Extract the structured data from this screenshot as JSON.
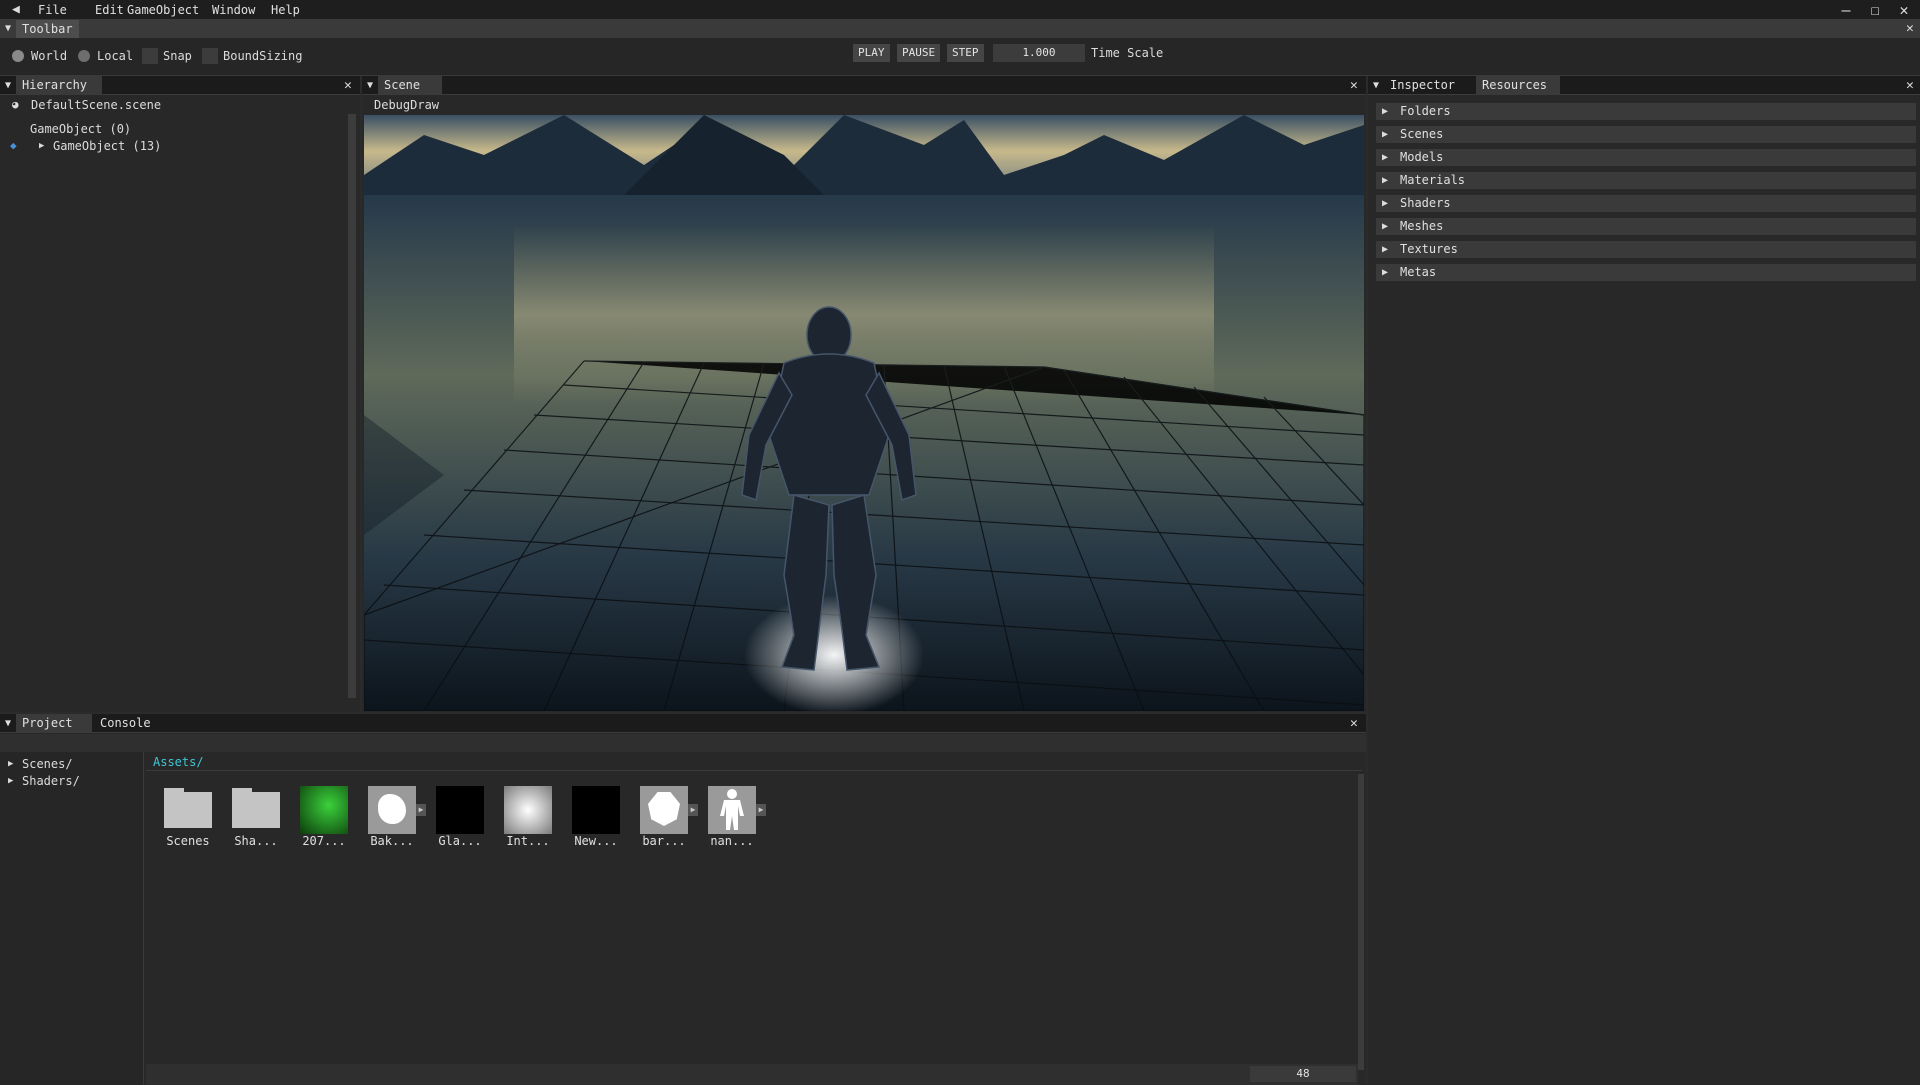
{
  "menubar": {
    "items": [
      "File",
      "Edit",
      "GameObject",
      "Window",
      "Help"
    ]
  },
  "toolbar": {
    "title": "Toolbar",
    "world_label": "World",
    "local_label": "Local",
    "snap_label": "Snap",
    "bound_label": "BoundSizing",
    "play": "PLAY",
    "pause": "PAUSE",
    "step": "STEP",
    "time_scale_value": "1.000",
    "time_scale_label": "Time Scale"
  },
  "hierarchy": {
    "tab": "Hierarchy",
    "scene_file": "DefaultScene.scene",
    "items": [
      "GameObject (0)",
      "GameObject (13)"
    ]
  },
  "scene": {
    "tab": "Scene",
    "overlay_label": "DebugDraw"
  },
  "inspector": {
    "tabs": [
      "Inspector",
      "Resources"
    ],
    "resources": [
      "Folders",
      "Scenes",
      "Models",
      "Materials",
      "Shaders",
      "Meshes",
      "Textures",
      "Metas"
    ]
  },
  "project": {
    "tabs": [
      "Project",
      "Console"
    ],
    "tree": [
      "Scenes/",
      "Shaders/"
    ],
    "breadcrumb": "Assets/",
    "assets": [
      "Scenes",
      "Sha...",
      "207...",
      "Bak...",
      "Gla...",
      "Int...",
      "New...",
      "bar...",
      "nan..."
    ],
    "zoom_value": "48"
  },
  "colors": {
    "accent_path": "#3fc7d6",
    "panel_bg": "#282828",
    "titlebar_bg": "#1b1b1b"
  }
}
